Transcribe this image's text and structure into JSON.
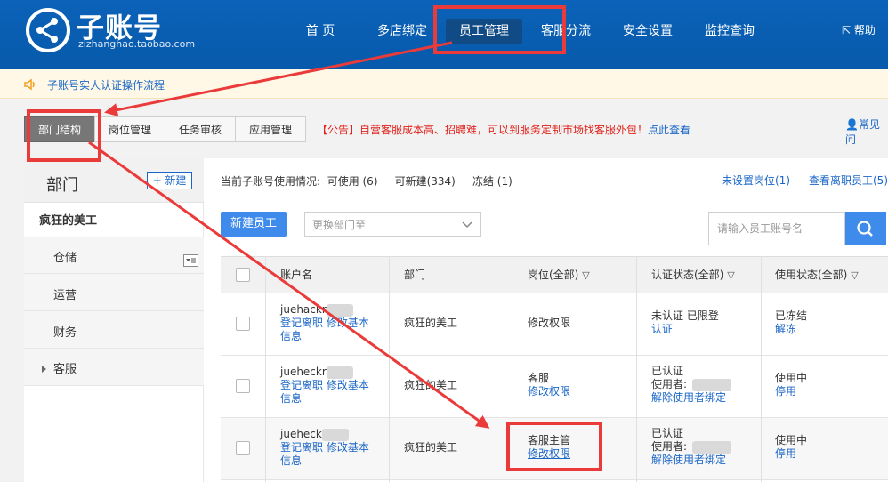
{
  "header": {
    "logo_title": "子账号",
    "logo_url": "zizhanghao.taobao.com",
    "nav": [
      "首 页",
      "多店绑定",
      "员工管理",
      "客服分流",
      "安全设置",
      "监控查询"
    ],
    "help": "帮助"
  },
  "notice": {
    "text": "子账号实人认证操作流程"
  },
  "tabs": [
    "部门结构",
    "岗位管理",
    "任务审核",
    "应用管理"
  ],
  "announcement": {
    "text": "【公告】自营客服成本高、招聘难，可以到服务定制市场找客服外包！",
    "link": "点此查看"
  },
  "faq": "常见问",
  "departments": {
    "title": "部门",
    "new_button": "+ 新建",
    "items": [
      "疯狂的美工",
      "仓储",
      "运营",
      "财务",
      "客服"
    ]
  },
  "usage": {
    "label": "当前子账号使用情况:",
    "available": "可使用 (6)",
    "creatable": "可新建(334)",
    "frozen": "冻结 (1)",
    "unset_position": "未设置岗位(1)",
    "view_left": "查看离职员工(5)"
  },
  "toolbar": {
    "new_employee": "新建员工",
    "change_dept_placeholder": "更换部门至",
    "search_placeholder": "请输入员工账号名"
  },
  "table": {
    "columns": [
      "账户名",
      "部门",
      "岗位(全部)",
      "认证状态(全部)",
      "使用状态(全部)"
    ],
    "rows": [
      {
        "account": "juehackr",
        "links": "登记离职 修改基本",
        "links2": "信息",
        "dept": "疯狂的美工",
        "position": "",
        "position_link": "修改权限",
        "auth": "未认证 已限登",
        "auth_link": "认证",
        "auth_user": "",
        "status": "已冻结",
        "status_link": "解冻"
      },
      {
        "account": "jueheckr",
        "links": "登记离职 修改基本",
        "links2": "信息",
        "dept": "疯狂的美工",
        "position": "客服",
        "position_link": "修改权限",
        "auth": "已认证",
        "auth_link": "解除使用者绑定",
        "auth_user": "使用者:",
        "status": "使用中",
        "status_link": "停用"
      },
      {
        "account": "jueheck",
        "links": "登记离职 修改基本",
        "links2": "信息",
        "dept": "疯狂的美工",
        "position": "客服主管",
        "position_link": "修改权限",
        "auth": "已认证",
        "auth_link": "解除使用者绑定",
        "auth_user": "使用者:",
        "status": "使用中",
        "status_link": "停用"
      }
    ]
  },
  "colors": {
    "header_blue": "#0b62b8",
    "link_blue": "#1a66c7",
    "annotation_red": "#ea3a3a",
    "button_blue": "#3f8bec"
  }
}
